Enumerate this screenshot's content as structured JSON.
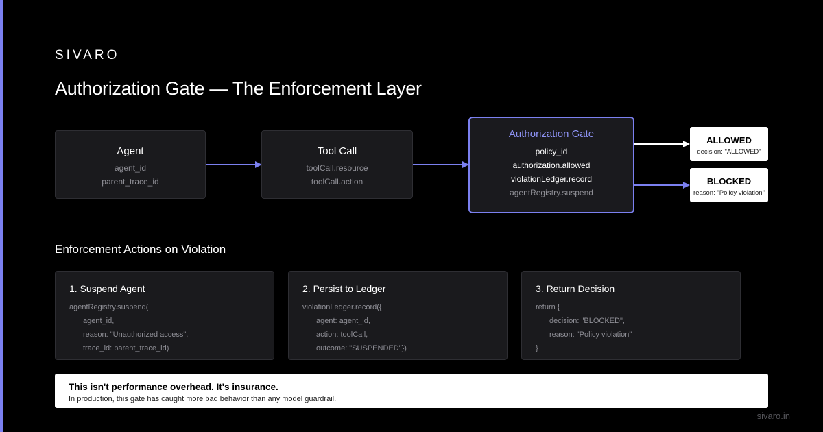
{
  "brand": "SIVARO",
  "title": "Authorization Gate — The Enforcement Layer",
  "flow": {
    "agent": {
      "name": "Agent",
      "fields": [
        "agent_id",
        "parent_trace_id"
      ]
    },
    "tool_call": {
      "name": "Tool Call",
      "fields": [
        "toolCall.resource",
        "toolCall.action"
      ]
    },
    "gate": {
      "name": "Authorization Gate",
      "fields": [
        "policy_id",
        "authorization.allowed",
        "violationLedger.record",
        "agentRegistry.suspend"
      ]
    },
    "allowed": {
      "label": "ALLOWED",
      "detail": "decision: \"ALLOWED\""
    },
    "blocked": {
      "label": "BLOCKED",
      "detail": "reason: \"Policy violation\""
    }
  },
  "section_title": "Enforcement Actions on Violation",
  "actions": [
    {
      "title": "1. Suspend Agent",
      "lines": [
        "agentRegistry.suspend(",
        "agent_id,",
        "reason: \"Unauthorized access\",",
        "trace_id: parent_trace_id)"
      ]
    },
    {
      "title": "2. Persist to Ledger",
      "lines": [
        "violationLedger.record({",
        "agent: agent_id,",
        "action: toolCall,",
        "outcome: \"SUSPENDED\"})"
      ]
    },
    {
      "title": "3. Return Decision",
      "lines": [
        "return {",
        "decision: \"BLOCKED\",",
        "reason: \"Policy violation\"",
        "}"
      ]
    }
  ],
  "callout": {
    "headline": "This isn't performance overhead. It's insurance.",
    "sub": "In production, this gate has caught more bad behavior than any model guardrail."
  },
  "footer": "sivaro.in",
  "colors": {
    "accent": "#7b80f0",
    "background": "#000000",
    "card": "#1a1a1d"
  }
}
